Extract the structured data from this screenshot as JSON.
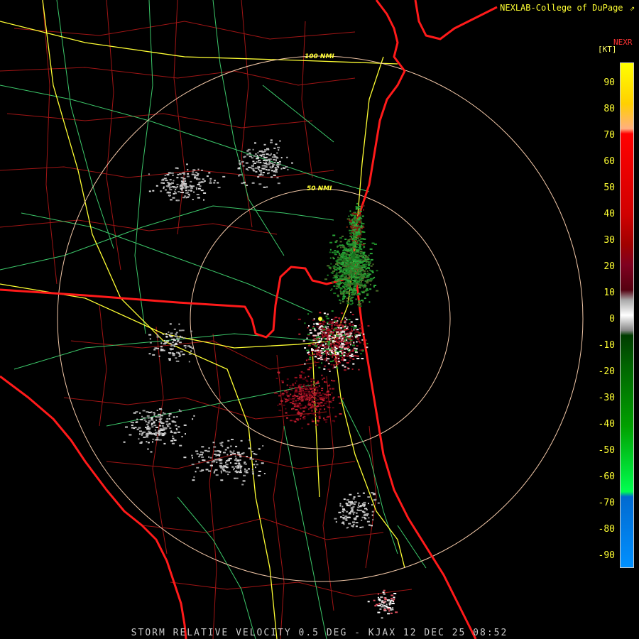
{
  "header": {
    "credit": "NEXLAB-College of DuPage",
    "product_code": "NEXR",
    "units": "[KT]"
  },
  "legend": {
    "ticks": [
      "90",
      "80",
      "70",
      "60",
      "50",
      "40",
      "30",
      "20",
      "10",
      "0",
      "-10",
      "-20",
      "-30",
      "-40",
      "-50",
      "-60",
      "-70",
      "-80",
      "-90"
    ]
  },
  "range_rings": {
    "inner_label": "50 NMI",
    "outer_label": "100 NMI"
  },
  "footer": {
    "caption": "STORM RELATIVE VELOCITY 0.5 DEG - KJAX 12 DEC 25 08:52"
  },
  "colors": {
    "background": "#000000",
    "state_border": "#ff1a1a",
    "county_line": "#b01818",
    "highway": "#ffff33",
    "road": "#4dd27a",
    "range_ring": "#f3c8a8",
    "inbound": "#1f8f2a",
    "outbound": "#9a1020",
    "noise": "#bfbfbf"
  },
  "icons": {
    "radar_site": "radar-site-marker"
  }
}
